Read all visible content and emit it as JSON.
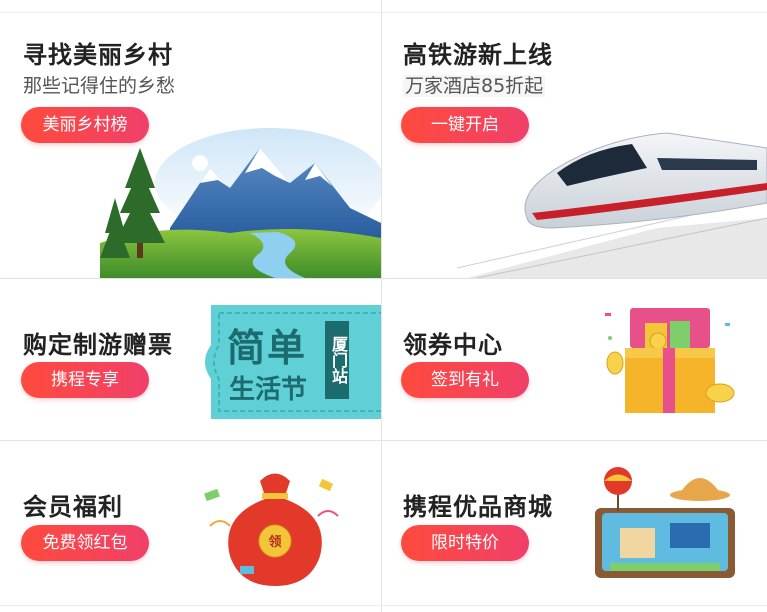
{
  "cells": [
    {
      "title": "寻找美丽乡村",
      "subtitle": "那些记得住的乡愁",
      "button": "美丽乡村榜"
    },
    {
      "title": "高铁游新上线",
      "subtitle": "万家酒店85折起",
      "button": "一键开启"
    },
    {
      "title": "购定制游赠票",
      "button": "携程专享",
      "ticket_text_main_1": "简单",
      "ticket_text_main_2": "生活节",
      "ticket_text_side": "厦门站"
    },
    {
      "title": "领券中心",
      "button": "签到有礼"
    },
    {
      "title": "会员福利",
      "button": "免费领红包",
      "bag_label": "领"
    },
    {
      "title": "携程优品商城",
      "button": "限时特价"
    }
  ],
  "colors": {
    "button_gradient_start": "#ff4a3d",
    "button_gradient_end": "#f0406a",
    "ticket_bg": "#5fd0d6",
    "ticket_text": "#1c6b6e"
  },
  "icons": [
    "mountain-landscape-icon",
    "high-speed-train-icon",
    "ticket-icon",
    "gift-box-icon",
    "red-envelope-bag-icon",
    "suitcase-travel-icon"
  ]
}
